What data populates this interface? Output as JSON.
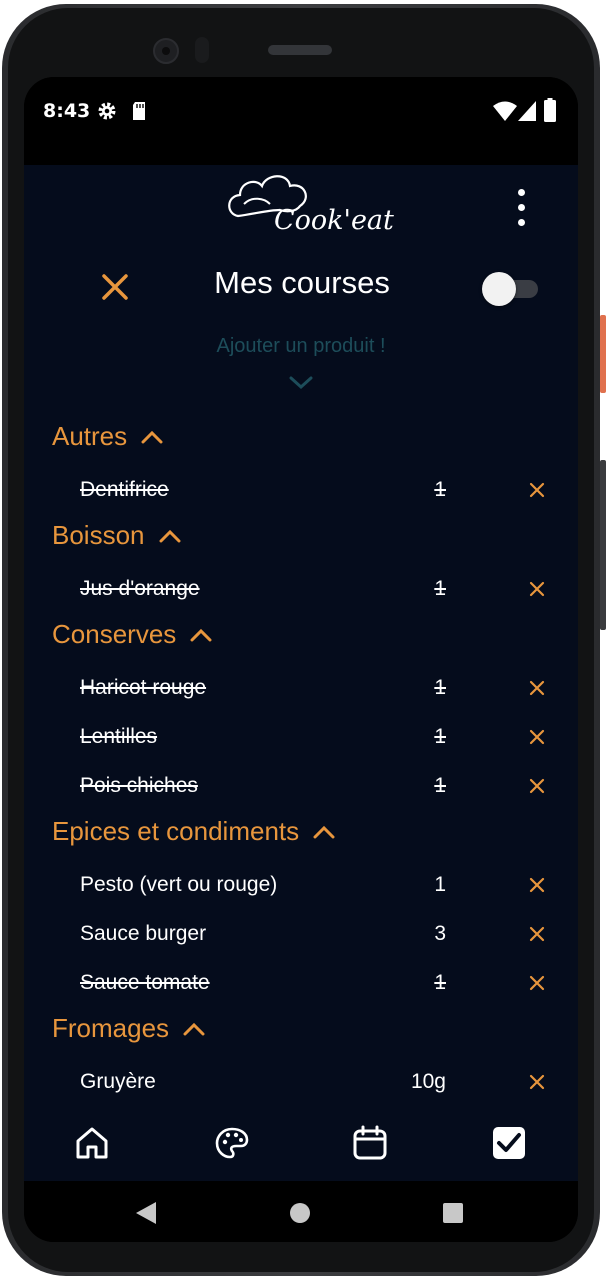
{
  "status_bar": {
    "time": "8:43",
    "icons": [
      "gear-icon",
      "sd-card-icon",
      "wifi-icon",
      "signal-icon",
      "battery-icon"
    ]
  },
  "header": {
    "logo_text": "Cook'eat",
    "title": "Mes courses",
    "toggle_on": false
  },
  "add_product": {
    "label": "Ajouter un produit !"
  },
  "colors": {
    "background": "#050c1c",
    "accent": "#e8963d",
    "muted": "#1d4d5a",
    "text": "#ffffff"
  },
  "categories": [
    {
      "name": "Autres",
      "items": [
        {
          "name": "Dentifrice",
          "qty": "1",
          "checked": true
        }
      ]
    },
    {
      "name": "Boisson",
      "items": [
        {
          "name": "Jus d'orange",
          "qty": "1",
          "checked": true
        }
      ]
    },
    {
      "name": "Conserves",
      "items": [
        {
          "name": "Haricot rouge ",
          "qty": "1",
          "checked": true
        },
        {
          "name": "Lentilles ",
          "qty": "1",
          "checked": true
        },
        {
          "name": "Pois chiches ",
          "qty": "1",
          "checked": true
        }
      ]
    },
    {
      "name": "Epices et condiments",
      "items": [
        {
          "name": "Pesto (vert ou rouge)",
          "qty": "1",
          "checked": false
        },
        {
          "name": "Sauce burger",
          "qty": "3",
          "checked": false
        },
        {
          "name": "Sauce tomate ",
          "qty": "1",
          "checked": true
        }
      ]
    },
    {
      "name": "Fromages",
      "items": [
        {
          "name": "Gruyère",
          "qty": "10g",
          "checked": false
        }
      ]
    }
  ],
  "bottom_nav": [
    "home-icon",
    "palette-icon",
    "calendar-icon",
    "checklist-icon"
  ],
  "system_nav": [
    "back-icon",
    "home-circle-icon",
    "recents-icon"
  ]
}
